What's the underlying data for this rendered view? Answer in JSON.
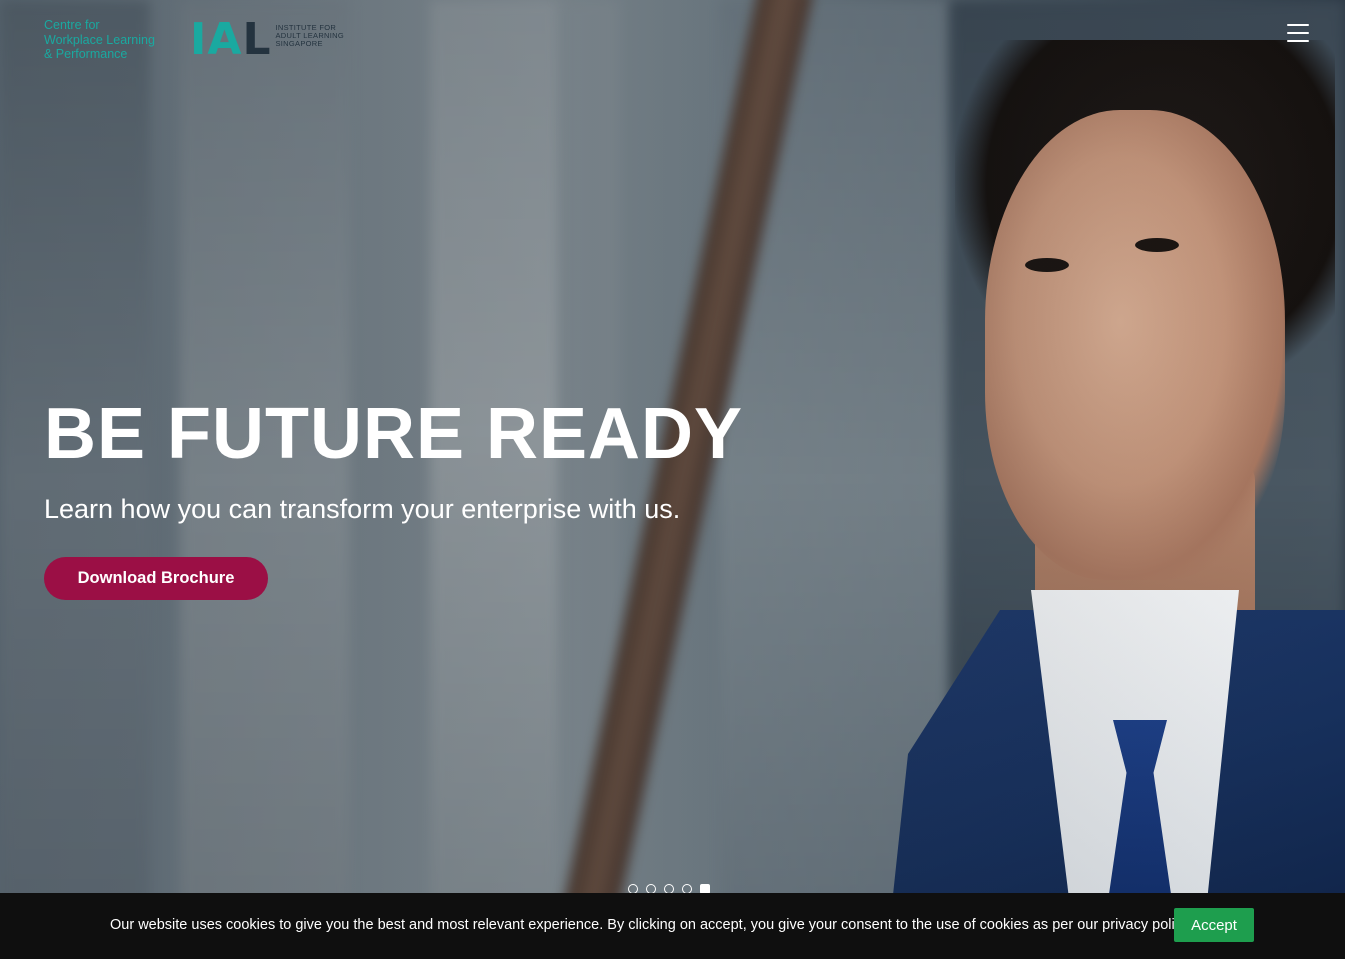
{
  "header": {
    "cwlp_logo_lines": [
      "Centre for",
      "Workplace Learning",
      "& Performance"
    ],
    "ial_mark_main": "IA",
    "ial_mark_last": "L",
    "ial_text_lines": [
      "INSTITUTE FOR",
      "ADULT LEARNING",
      "SINGAPORE"
    ]
  },
  "hero": {
    "headline": "BE FUTURE READY",
    "subline": "Learn how you can transform your enterprise with us.",
    "cta_label": "Download Brochure"
  },
  "carousel": {
    "slide_count": 5,
    "active_index": 4
  },
  "cookie_bar": {
    "message": "Our website uses cookies to give you the best and most relevant experience. By clicking on accept, you give your consent to the use of cookies as per our privacy policy.",
    "accept_label": "Accept"
  },
  "colors": {
    "brand_teal": "#1aa9a0",
    "brand_navy": "#24333f",
    "cta_maroon": "#9b0f45",
    "accept_green": "#1e9e4e"
  },
  "icons": {
    "menu": "hamburger-menu-icon"
  }
}
